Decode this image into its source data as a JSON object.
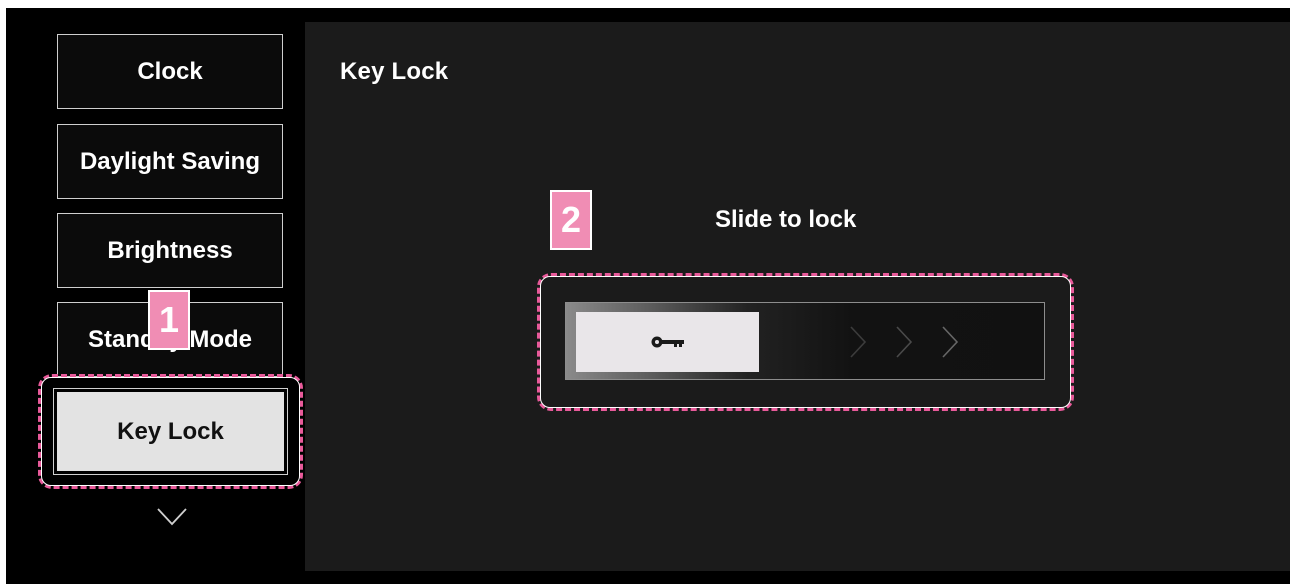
{
  "panel": {
    "title": "Key Lock"
  },
  "menu": {
    "items": [
      {
        "label": "Clock"
      },
      {
        "label": "Daylight Saving"
      },
      {
        "label": "Brightness"
      },
      {
        "label": "Standby Mode"
      },
      {
        "label": "Key Lock",
        "selected": true
      }
    ],
    "scroll_icon": "chevron-down-icon"
  },
  "slider": {
    "label": "Slide to lock",
    "handle_icon": "key-icon",
    "arrow_icon": "chevron-right-icon"
  },
  "annotations": {
    "callout_1": "1",
    "callout_2": "2",
    "highlight_color": "#e85a9a",
    "badge_color": "#f08db4"
  }
}
